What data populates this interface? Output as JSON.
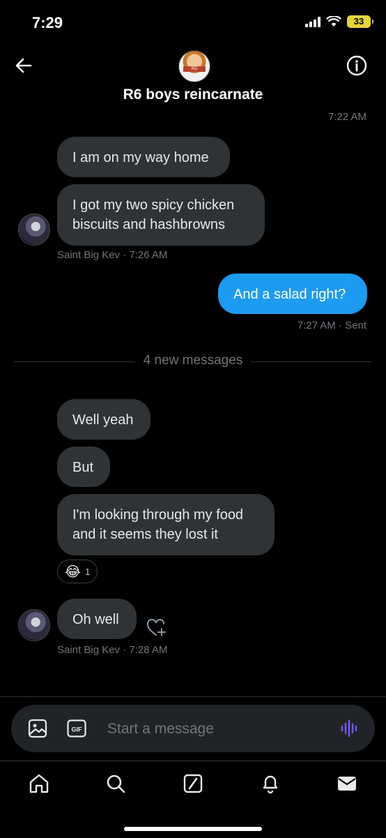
{
  "status": {
    "time": "7:29",
    "battery": "33"
  },
  "header": {
    "title": "R6 boys reincarnate",
    "avatar_caption": "RD RECORDS"
  },
  "messages": {
    "ts_top": "7:22 AM",
    "m1": "I am on my way home",
    "m2_line1": "I got my two spicy chicken",
    "m2_line2": "biscuits and hashbrowns",
    "meta1": "Saint Big Kev · 7:26 AM",
    "m3": "And a salad right?",
    "meta_sent": "7:27 AM · Sent",
    "divider": "4 new messages",
    "m4": "Well yeah",
    "m5": "But",
    "m6_line1": "I'm looking through my food",
    "m6_line2": "and it seems they lost it",
    "reaction_emoji": "😂",
    "reaction_count": "1",
    "m7": "Oh well",
    "meta2": "Saint Big Kev · 7:28 AM"
  },
  "composer": {
    "placeholder": "Start a message",
    "gif_label": "GIF"
  },
  "colors": {
    "accent": "#1d9bf0",
    "bubble_in": "#2f3336",
    "muted": "#71767b",
    "voice": "#7856ff"
  }
}
